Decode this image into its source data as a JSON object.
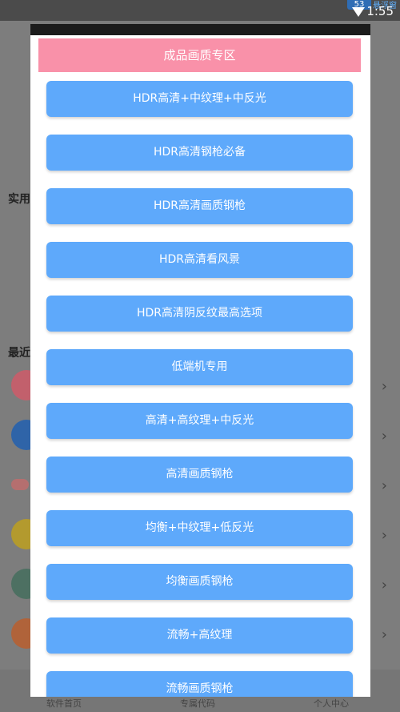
{
  "status_bar": {
    "time": "1:55",
    "badge": "53",
    "hint": "悬浮窗"
  },
  "background": {
    "section_practical": "实用",
    "section_recent": "最近",
    "nav": [
      "软件首页",
      "专属代码",
      "个人中心"
    ]
  },
  "dialog": {
    "header": "成品画质专区",
    "presets": [
      "HDR高清+中纹理+中反光",
      "HDR高清钢枪必备",
      "HDR高清画质钢枪",
      "HDR高清看风景",
      "HDR高清阴反纹最高选项",
      "低端机专用",
      "高清+高纹理+中反光",
      "高清画质钢枪",
      "均衡+中纹理+低反光",
      "均衡画质钢枪",
      "流畅+高纹理",
      "流畅画质钢枪"
    ]
  },
  "colors": {
    "header_pink": "#f991a9",
    "button_blue": "#5ea9fb",
    "dim_overlay": "#7d7d7d"
  }
}
